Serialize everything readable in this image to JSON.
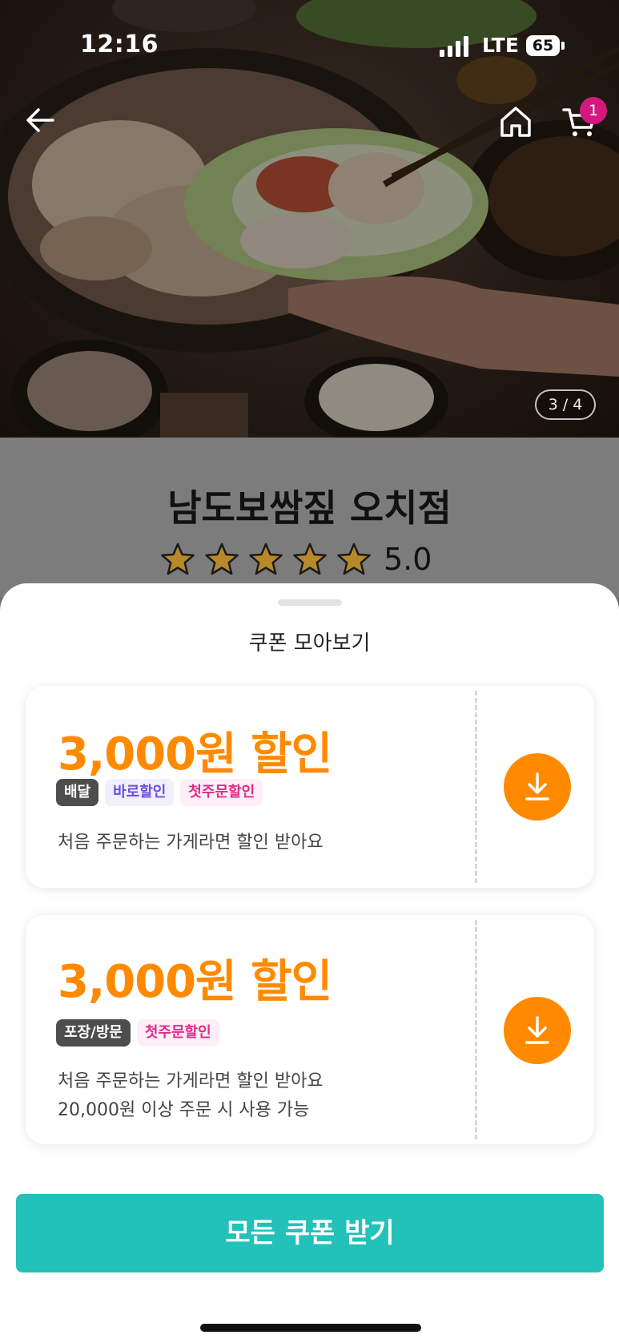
{
  "status_bar": {
    "time": "12:16",
    "network": "LTE",
    "battery": "65"
  },
  "header": {
    "back_icon": "arrow-left-icon",
    "home_icon": "home-icon",
    "cart_icon": "cart-icon",
    "cart_count": "1"
  },
  "gallery": {
    "indicator": "3 / 4"
  },
  "store": {
    "name": "남도보쌈짚 오치점",
    "rating": "5.0",
    "stars": 5
  },
  "sheet": {
    "title": "쿠폰 모아보기",
    "coupons": [
      {
        "amount": "3,000원 할인",
        "tags": [
          "배달",
          "바로할인",
          "첫주문할인"
        ],
        "desc_lines": [
          "처음 주문하는 가게라면 할인 받아요"
        ]
      },
      {
        "amount": "3,000원 할인",
        "tags": [
          "포장/방문",
          "첫주문할인"
        ],
        "desc_lines": [
          "처음 주문하는 가게라면 할인 받아요",
          "20,000원 이상 주문 시 사용 가능"
        ]
      }
    ],
    "all_button": "모든 쿠폰 받기"
  },
  "colors": {
    "accent_orange": "#ff8a00",
    "primary_teal": "#22c1b9",
    "badge_pink": "#d4187e"
  }
}
